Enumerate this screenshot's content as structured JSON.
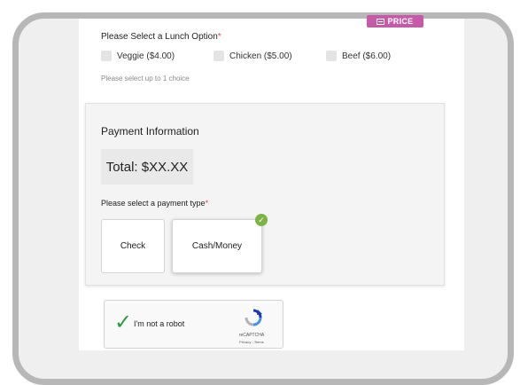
{
  "badge": {
    "label": "PRICE"
  },
  "lunch": {
    "title": "Please Select a Lunch Option",
    "required_mark": "*",
    "options": [
      {
        "label": "Veggie ($4.00)",
        "checked": false
      },
      {
        "label": "Chicken ($5.00)",
        "checked": false
      },
      {
        "label": "Beef ($6.00)",
        "checked": false
      }
    ],
    "hint": "Please select up to 1 choice"
  },
  "payment": {
    "title": "Payment Information",
    "total": "Total: $XX.XX",
    "type_label": "Please select a payment type",
    "required_mark": "*",
    "types": [
      {
        "label": "Check",
        "selected": false
      },
      {
        "label": "Cash/Money",
        "selected": true
      }
    ]
  },
  "recaptcha": {
    "label": "I'm not a robot",
    "brand": "reCAPTCHA",
    "links": "Privacy - Terms",
    "checked": true
  },
  "colors": {
    "badge": "#c45aa8",
    "required": "#e0435c",
    "selected_check": "#7cb342",
    "recaptcha_check": "#2e9a44"
  }
}
